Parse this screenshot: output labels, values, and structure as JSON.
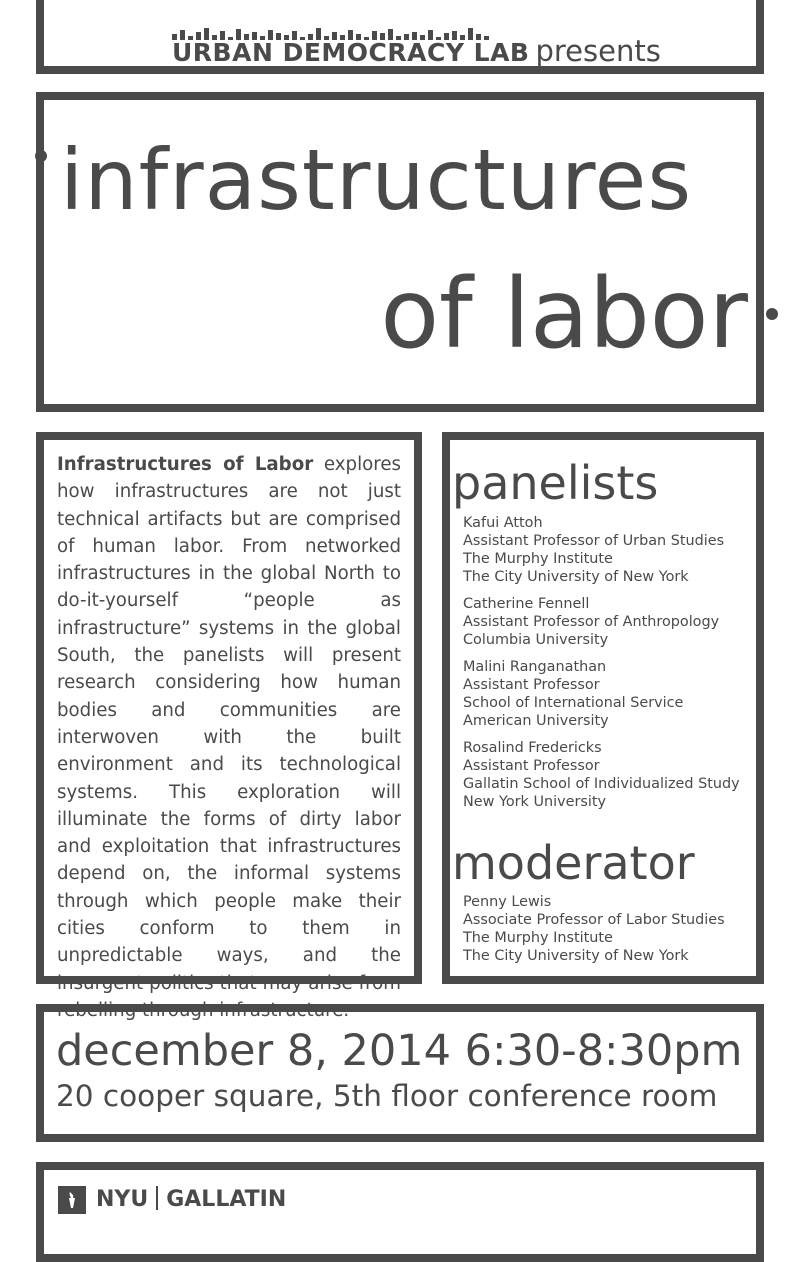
{
  "header": {
    "org": "URBAN DEMOCRACY LAB",
    "presents": "presents"
  },
  "title": {
    "line1": "infrastructures",
    "line2": "of labor"
  },
  "description": {
    "lead": "Infrastructures of Labor",
    "body": " explores how infrastructures are not just technical artifacts but are comprised of human labor.  From networked infrastructures in the global North to do-it-yourself “people as infrastructure” systems in the global South, the panelists will present research considering how human bodies and communities are interwoven with the built environment and its technological systems. This exploration will illuminate the forms of dirty labor and exploitation that infrastructures depend on, the informal systems through which people make their cities conform to them in unpredictable ways, and the insurgent politics that may arise from rebelling through infrastructure."
  },
  "panelists": {
    "heading": "panelists",
    "items": [
      {
        "name": "Kafui Attoh",
        "lines": [
          "Assistant Professor of Urban Studies",
          "The Murphy Institute",
          "The City University of New York"
        ]
      },
      {
        "name": "Catherine Fennell",
        "lines": [
          "Assistant Professor of Anthropology",
          "Columbia University"
        ]
      },
      {
        "name": "Malini Ranganathan",
        "lines": [
          "Assistant Professor",
          "School of International Service",
          "American University"
        ]
      },
      {
        "name": "Rosalind Fredericks",
        "lines": [
          "Assistant Professor",
          "Gallatin School of Individualized Study",
          "New York University"
        ]
      }
    ]
  },
  "moderator": {
    "heading": "moderator",
    "name": "Penny Lewis",
    "lines": [
      "Associate Professor of Labor Studies",
      "The Murphy Institute",
      "The City University of New York"
    ]
  },
  "event": {
    "datetime": "december 8, 2014 6:30-8:30pm",
    "location": "20 cooper square, 5th floor conference room"
  },
  "footer": {
    "nyu": "NYU",
    "gallatin": "GALLATIN",
    "logo_icon": "torch-icon"
  },
  "colors": {
    "ink": "#4a4a4a",
    "background": "#ffffff"
  }
}
